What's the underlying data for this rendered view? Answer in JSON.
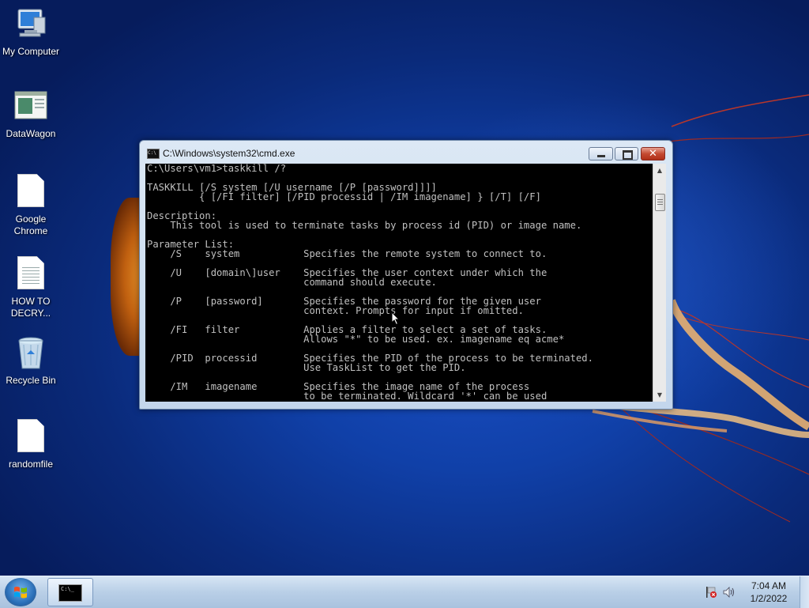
{
  "desktop": {
    "icons": [
      {
        "label": "My Computer",
        "icon": "computer-icon"
      },
      {
        "label": "DataWagon",
        "icon": "app-window-icon"
      },
      {
        "label": "Google Chrome",
        "icon": "blank-file-icon"
      },
      {
        "label": "HOW TO DECRY...",
        "icon": "text-file-icon"
      },
      {
        "label": "Recycle Bin",
        "icon": "recycle-bin-icon"
      },
      {
        "label": "randomfile",
        "icon": "blank-file-icon"
      }
    ]
  },
  "window": {
    "title": "C:\\Windows\\system32\\cmd.exe",
    "console_text": "C:\\Users\\vm1>taskkill /?\n\nTASKKILL [/S system [/U username [/P [password]]]]\n         { [/FI filter] [/PID processid | /IM imagename] } [/T] [/F]\n\nDescription:\n    This tool is used to terminate tasks by process id (PID) or image name.\n\nParameter List:\n    /S    system           Specifies the remote system to connect to.\n\n    /U    [domain\\]user    Specifies the user context under which the\n                           command should execute.\n\n    /P    [password]       Specifies the password for the given user\n                           context. Prompts for input if omitted.\n\n    /FI   filter           Applies a filter to select a set of tasks.\n                           Allows \"*\" to be used. ex. imagename eq acme*\n\n    /PID  processid        Specifies the PID of the process to be terminated.\n                           Use TaskList to get the PID.\n\n    /IM   imagename        Specifies the image name of the process\n                           to be terminated. Wildcard '*' can be used",
    "minimize_symbol": "",
    "close_symbol": "✕",
    "scroll_up": "▲",
    "scroll_down": "▼"
  },
  "taskbar": {
    "start_icon": "windows-start-icon",
    "task_icon_text": "C:\\_",
    "clock_time": "7:04 AM",
    "clock_date": "1/2/2022"
  },
  "colors": {
    "console_bg": "#000000",
    "console_fg": "#c0c0c0",
    "desktop_blue": "#1040a8"
  }
}
